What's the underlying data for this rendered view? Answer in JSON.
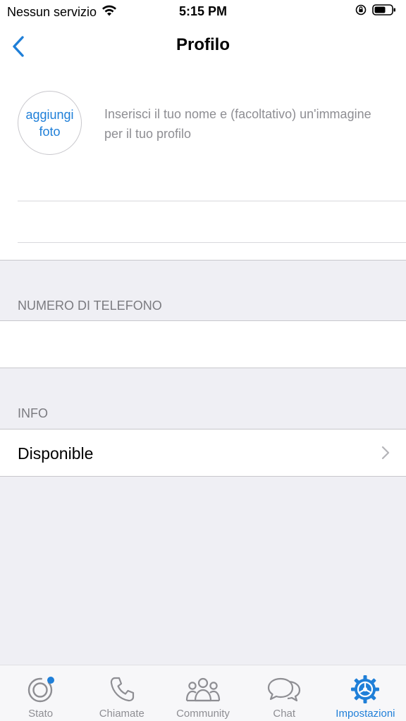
{
  "status_bar": {
    "carrier": "Nessun servizio",
    "time": "5:15 PM"
  },
  "nav": {
    "title": "Profilo"
  },
  "profile": {
    "add_photo_label": "aggiungi foto",
    "hint": "Inserisci il tuo nome e (facoltativo) un'immagine per il tuo profilo",
    "name_value": ""
  },
  "phone_section": {
    "header": "NUMERO DI TELEFONO",
    "value": ""
  },
  "info_section": {
    "header": "INFO",
    "value": "Disponible"
  },
  "tabs": [
    {
      "label": "Stato",
      "icon": "status-icon"
    },
    {
      "label": "Chiamate",
      "icon": "phone-icon"
    },
    {
      "label": "Community",
      "icon": "community-icon"
    },
    {
      "label": "Chat",
      "icon": "chat-icon"
    },
    {
      "label": "Impostazioni",
      "icon": "settings-icon",
      "active": true
    }
  ],
  "colors": {
    "accent": "#1f7fd8",
    "background": "#efeff4",
    "secondary_text": "#8e8e93"
  }
}
